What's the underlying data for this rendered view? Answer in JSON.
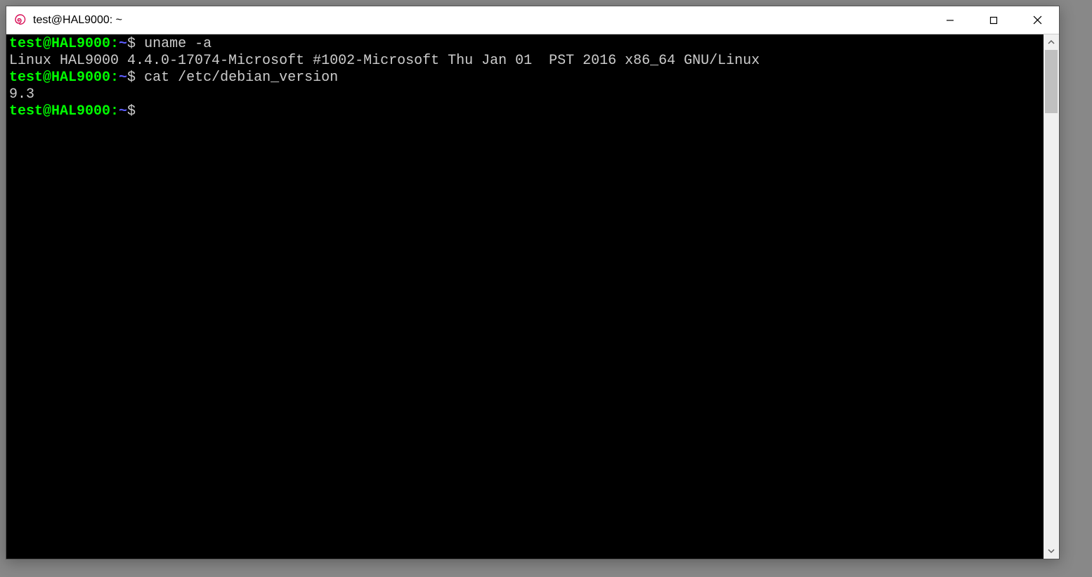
{
  "window": {
    "title": "test@HAL9000: ~"
  },
  "terminal": {
    "lines": [
      {
        "prompt_user": "test@HAL9000:",
        "prompt_path": "~",
        "prompt_dollar": "$",
        "command": "uname -a"
      },
      {
        "output": "Linux HAL9000 4.4.0-17074-Microsoft #1002-Microsoft Thu Jan 01  PST 2016 x86_64 GNU/Linux"
      },
      {
        "prompt_user": "test@HAL9000:",
        "prompt_path": "~",
        "prompt_dollar": "$",
        "command": "cat /etc/debian_version"
      },
      {
        "output": "9.3"
      },
      {
        "prompt_user": "test@HAL9000:",
        "prompt_path": "~",
        "prompt_dollar": "$",
        "command": ""
      }
    ]
  }
}
